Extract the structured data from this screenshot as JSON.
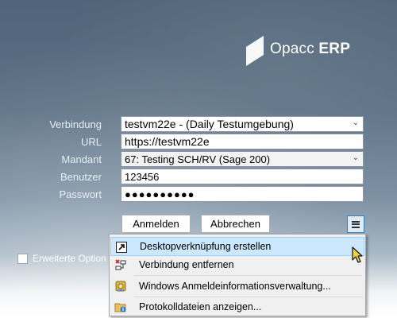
{
  "branding": {
    "logo_part1": "Opacc",
    "logo_part2": "ERP"
  },
  "form": {
    "connection": {
      "label": "Verbindung",
      "value": "testvm22e - (Daily Testumgebung)"
    },
    "url": {
      "label": "URL",
      "value": "https://testvm22e"
    },
    "tenant": {
      "label": "Mandant",
      "value": "67: Testing SCH/RV (Sage 200)"
    },
    "user": {
      "label": "Benutzer",
      "value": "123456"
    },
    "password": {
      "label": "Passwort",
      "value": "●●●●●●●●●●"
    }
  },
  "buttons": {
    "login": "Anmelden",
    "cancel": "Abbrechen"
  },
  "advanced": {
    "label": "Erweiterte Option"
  },
  "menu": {
    "items": [
      {
        "label": "Desktopverknüpfung erstellen",
        "icon": "shortcut-arrow-icon"
      },
      {
        "label": "Verbindung entfernen",
        "icon": "remove-connection-icon"
      },
      {
        "label": "Windows Anmeldeinformationsverwaltung...",
        "icon": "credential-vault-icon"
      },
      {
        "label": "Protokolldateien anzeigen...",
        "icon": "log-files-icon"
      }
    ]
  },
  "colors": {
    "accent": "#3c7fb1",
    "highlight": "#cce8ff"
  }
}
